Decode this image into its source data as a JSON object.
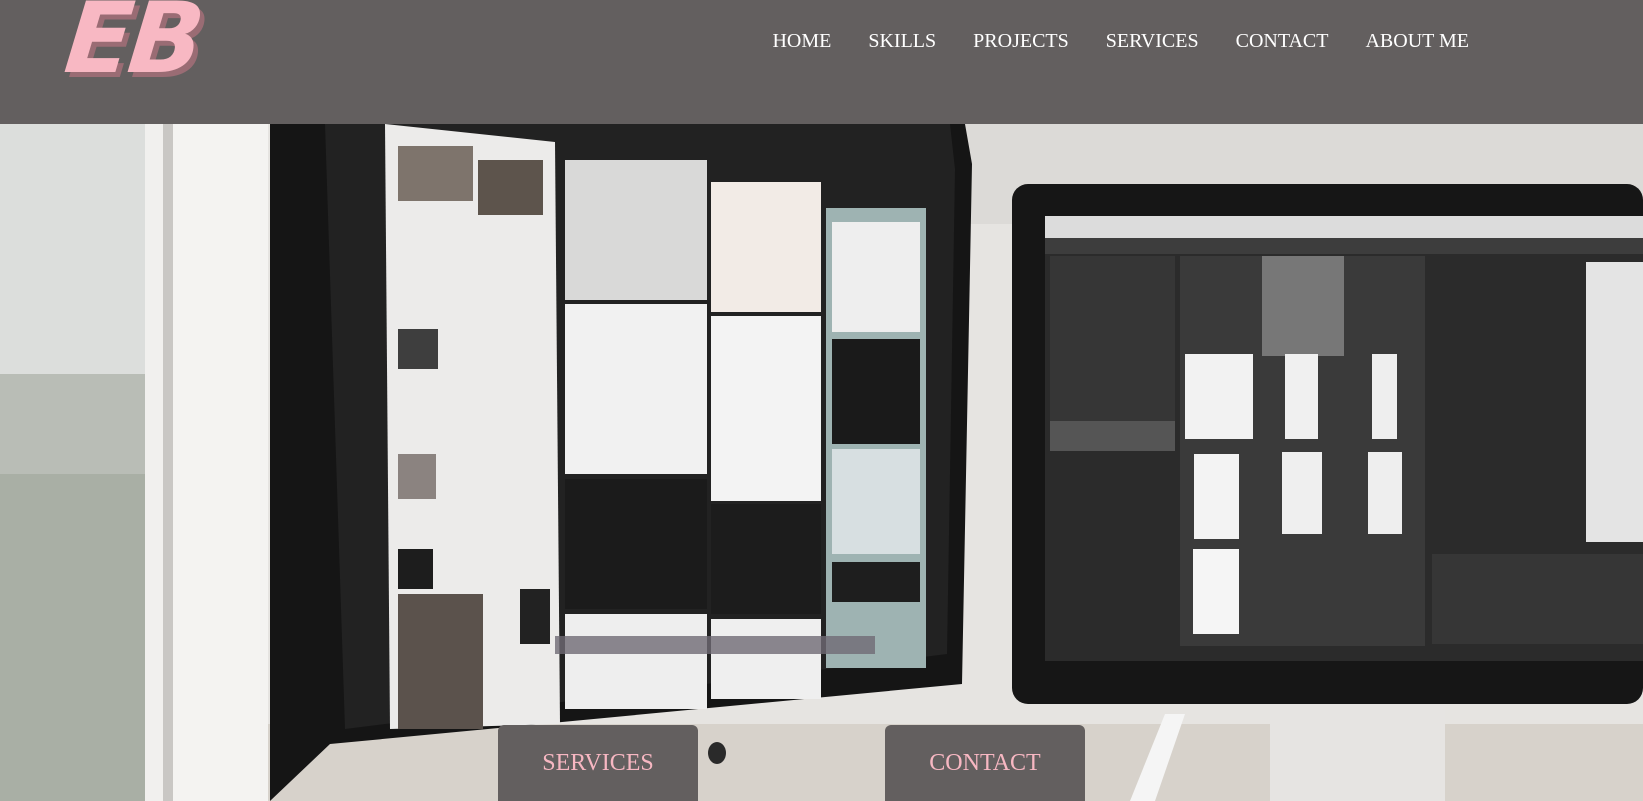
{
  "brand": {
    "logo_text": "EB",
    "logo_color": "#f8b8c3"
  },
  "nav": {
    "items": [
      {
        "label": "HOME"
      },
      {
        "label": "SKILLS"
      },
      {
        "label": "PROJECTS"
      },
      {
        "label": "SERVICES"
      },
      {
        "label": "CONTACT"
      },
      {
        "label": "ABOUT ME"
      }
    ],
    "background": "#635f5f"
  },
  "hero": {
    "image": "photo-of-two-monitors-showing-design-layouts",
    "buttons": {
      "services_label": "SERVICES",
      "contact_label": "CONTACT"
    },
    "button_bg": "#635f5f",
    "button_text_color": "#f7b7c2"
  }
}
